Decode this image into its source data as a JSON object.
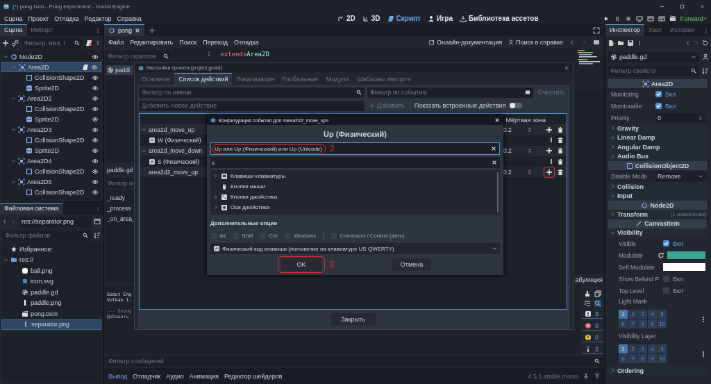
{
  "window": {
    "title": "(*) pong.tscn - Pong experiment - Godot Engine"
  },
  "menu": [
    "Сцена",
    "Проект",
    "Отладка",
    "Редактор",
    "Справка"
  ],
  "workspaces": [
    {
      "label": "2D",
      "kind": "plane",
      "selected": false
    },
    {
      "label": "3D",
      "kind": "space",
      "selected": false
    },
    {
      "label": "Скрипт",
      "kind": "script",
      "selected": true
    },
    {
      "label": "Игра",
      "kind": "game",
      "selected": false
    },
    {
      "label": "Библиотека ассетов",
      "kind": "assetlib",
      "selected": false
    }
  ],
  "renderer": "Forward+",
  "scene_dock": {
    "tabs": [
      {
        "label": "Сцена",
        "selected": true
      },
      {
        "label": "Импорт",
        "selected": false
      }
    ],
    "filter": {
      "placeholder": "Фильтр: имя, t"
    },
    "tree": [
      {
        "name": "Node2D",
        "kind": "node2d",
        "selected": false,
        "script": false,
        "expanded": true,
        "children": [
          {
            "name": "Area2D",
            "kind": "area",
            "selected": true,
            "script": true,
            "expanded": true,
            "children": [
              {
                "name": "CollisionShape2D",
                "kind": "shape",
                "selected": false,
                "script": false
              },
              {
                "name": "Sprite2D",
                "kind": "sprite",
                "selected": false,
                "script": false
              }
            ]
          },
          {
            "name": "Area2D2",
            "kind": "area",
            "selected": false,
            "script": false,
            "expanded": true,
            "children": [
              {
                "name": "CollisionShape2D",
                "kind": "shape",
                "selected": false,
                "script": false
              },
              {
                "name": "Sprite2D",
                "kind": "sprite",
                "selected": false,
                "script": false
              }
            ]
          },
          {
            "name": "Area2D3",
            "kind": "area",
            "selected": false,
            "script": false,
            "expanded": true,
            "children": [
              {
                "name": "CollisionShape2D",
                "kind": "shape",
                "selected": false,
                "script": false
              },
              {
                "name": "Sprite2D",
                "kind": "sprite",
                "selected": false,
                "script": false
              }
            ]
          },
          {
            "name": "Area2D4",
            "kind": "area",
            "selected": false,
            "script": false,
            "expanded": true,
            "children": [
              {
                "name": "CollisionShape2D",
                "kind": "shape",
                "selected": false,
                "script": false
              }
            ]
          },
          {
            "name": "Area2D5",
            "kind": "area",
            "selected": false,
            "script": false,
            "expanded": true,
            "children": [
              {
                "name": "CollisionShape2D",
                "kind": "shape",
                "selected": false,
                "script": false
              }
            ]
          }
        ]
      }
    ]
  },
  "filesystem": {
    "tab": "Файловая система",
    "path": "res://separator.png",
    "filter": {
      "placeholder": "Фильтр файлов"
    },
    "tree": [
      {
        "name": "Избранное:",
        "kind": "favorites",
        "selected": false
      },
      {
        "name": "res://",
        "kind": "folder",
        "selected": false,
        "expanded": true,
        "children": [
          {
            "name": "ball.png",
            "kind": "ball",
            "selected": false
          },
          {
            "name": "icon.svg",
            "kind": "svg",
            "selected": false
          },
          {
            "name": "paddle.gd",
            "kind": "script",
            "selected": false
          },
          {
            "name": "paddle.png",
            "kind": "paddle",
            "selected": false
          },
          {
            "name": "pong.tscn",
            "kind": "scene",
            "selected": false
          },
          {
            "name": "separator.png",
            "kind": "separator",
            "selected": true
          }
        ]
      }
    ]
  },
  "script_editor": {
    "tabs": [
      {
        "label": "pong",
        "selected": true
      }
    ],
    "menu": [
      "Файл",
      "Редактировать",
      "Поиск",
      "Переход",
      "Отладка"
    ],
    "links": [
      "Онлайн-документация",
      "Поиск в справке"
    ],
    "script_filter": {
      "placeholder": "Фильтр скриптов"
    },
    "scripts": [
      {
        "name": "paddl",
        "selected": true
      }
    ],
    "current_script": "paddle.gd",
    "method_filter": {
      "placeholder": "Фильтр м"
    },
    "methods": [
      "_ready",
      "_process",
      "_on_area_"
    ],
    "code": [
      {
        "line": "1",
        "tokens": [
          {
            "text": "extends",
            "kind": "keyword"
          },
          {
            "text": "Area2D",
            "kind": "type"
          }
        ]
      }
    ],
    "status_tab": "абуляция"
  },
  "output": {
    "lines": [
      {
        "text": "Godot Eng",
        "kind": "info"
      },
      {
        "text": "Vulkan 1.",
        "kind": "info"
      },
      {
        "text": "--- Debug",
        "kind": "debug"
      },
      {
        "text": "Добавить",
        "kind": "note"
      }
    ],
    "counts": [
      {
        "kind": "message",
        "count": "3"
      },
      {
        "kind": "error",
        "count": "0"
      },
      {
        "kind": "warning",
        "count": "0"
      },
      {
        "kind": "info",
        "count": "2"
      }
    ],
    "filter": {
      "placeholder": "Фильтр сообщений"
    }
  },
  "bottom_tabs": [
    {
      "label": "Вывод",
      "selected": true
    },
    {
      "label": "Отладчик",
      "selected": false
    },
    {
      "label": "Аудио",
      "selected": false
    },
    {
      "label": "Анимация",
      "selected": false
    },
    {
      "label": "Редактор шейдеров",
      "selected": false
    }
  ],
  "version": "4.5.1.stable.mono",
  "inspector": {
    "tabs": [
      {
        "label": "Инспектор",
        "selected": true
      },
      {
        "label": "Узел",
        "selected": false
      },
      {
        "label": "История",
        "selected": false
      }
    ],
    "resource": "paddle.gd",
    "filter": {
      "placeholder": "Фильтр свойств"
    },
    "items": [
      {
        "kind": "category",
        "label": "Area2D"
      },
      {
        "kind": "check",
        "label": "Monitoring",
        "checked": true,
        "value": "Вкл"
      },
      {
        "kind": "check",
        "label": "Monitorable",
        "checked": true,
        "value": "Вкл"
      },
      {
        "kind": "number",
        "label": "Priority",
        "value": "0"
      },
      {
        "kind": "group",
        "label": "Gravity",
        "expanded": false
      },
      {
        "kind": "group",
        "label": "Linear Damp",
        "expanded": false
      },
      {
        "kind": "group",
        "label": "Angular Damp",
        "expanded": false
      },
      {
        "kind": "group",
        "label": "Audio Bus",
        "expanded": false
      },
      {
        "kind": "category",
        "label": "CollisionObject2D"
      },
      {
        "kind": "select",
        "label": "Disable Mode",
        "value": "Remove"
      },
      {
        "kind": "group",
        "label": "Collision",
        "expanded": false
      },
      {
        "kind": "group",
        "label": "Input",
        "expanded": false
      },
      {
        "kind": "category",
        "label": "Node2D"
      },
      {
        "kind": "group",
        "label": "Transform",
        "expanded": false,
        "note": "(1 изменение)"
      },
      {
        "kind": "category",
        "label": "CanvasItem"
      },
      {
        "kind": "group",
        "label": "Visibility",
        "expanded": true,
        "children": [
          {
            "kind": "check",
            "label": "Visible",
            "checked": true,
            "value": "Вкл"
          },
          {
            "kind": "color",
            "label": "Modulate",
            "color": "#3aa58f",
            "revert": true
          },
          {
            "kind": "color",
            "label": "Self Modulate",
            "color": "#ffffff"
          },
          {
            "kind": "check",
            "label": "Show Behind P",
            "checked": false,
            "value": "Вкл"
          },
          {
            "kind": "check",
            "label": "Top Level",
            "checked": false,
            "value": "Вкл"
          },
          {
            "kind": "layers",
            "label": "Light Mask",
            "layers": [
              {
                "label": "1",
                "selected": true
              },
              {
                "label": "2",
                "selected": false
              },
              {
                "label": "3",
                "selected": false
              },
              {
                "label": "4",
                "selected": false
              },
              {
                "label": "5",
                "selected": false
              },
              {
                "label": "6",
                "selected": false
              },
              {
                "label": "7",
                "selected": false
              },
              {
                "label": "8",
                "selected": false
              },
              {
                "label": "9",
                "selected": false
              },
              {
                "label": "10",
                "selected": false
              }
            ]
          },
          {
            "kind": "layers",
            "label": "Visibility Layer",
            "layers": [
              {
                "label": "1",
                "selected": true
              },
              {
                "label": "2",
                "selected": false
              },
              {
                "label": "3",
                "selected": false
              },
              {
                "label": "4",
                "selected": false
              },
              {
                "label": "5",
                "selected": false
              },
              {
                "label": "6",
                "selected": false
              },
              {
                "label": "7",
                "selected": false
              },
              {
                "label": "8",
                "selected": false
              },
              {
                "label": "9",
                "selected": false
              },
              {
                "label": "10",
                "selected": false
              }
            ]
          }
        ]
      },
      {
        "kind": "group",
        "label": "Ordering",
        "expanded": false
      }
    ]
  },
  "project_settings": {
    "title": "Настройки проекта (project.godot)",
    "tabs": [
      {
        "label": "Основное",
        "selected": false
      },
      {
        "label": "Список действий",
        "selected": true
      },
      {
        "label": "Локализация",
        "selected": false
      },
      {
        "label": "Глобальные",
        "selected": false
      },
      {
        "label": "Модули",
        "selected": false
      },
      {
        "label": "Шаблоны импорта",
        "selected": false
      }
    ],
    "name_filter": {
      "placeholder": "Фильтр по имени"
    },
    "event_filter": {
      "placeholder": "Фильтр по событию"
    },
    "clear_button": "Очистить",
    "new_action": {
      "placeholder": "Добавить новое действие"
    },
    "add_button": "Добавить",
    "show_builtin": {
      "label": "Показать встроенные действия",
      "on": false
    },
    "deadzone_header": "Мёртвая зона",
    "actions": [
      {
        "name": "area2d_move_up",
        "deadzone": "0.2",
        "expanded": true,
        "add_highlighted": false,
        "events": [
          {
            "label": "W (Физический)"
          }
        ]
      },
      {
        "name": "area2d_move_down",
        "deadzone": "0.2",
        "expanded": true,
        "add_highlighted": false,
        "events": [
          {
            "label": "S (Физический)"
          }
        ]
      },
      {
        "name": "area2d2_move_up",
        "deadzone": "0.2",
        "add_highlighted": true
      }
    ],
    "close_button": "Закрыть"
  },
  "event_dialog": {
    "title": "Конфигурация события для «area2d2_move_up»",
    "heading": "Up (Физический)",
    "detected": {
      "value": "Up или Up (Физический) или Up (Unicode)",
      "highlighted": true,
      "step": "2"
    },
    "search": {
      "value": "s"
    },
    "categories": [
      {
        "label": "Клавиши клавиатуры",
        "kind": "keyboard"
      },
      {
        "label": "Кнопки мыши",
        "kind": "mouse"
      },
      {
        "label": "Кнопки джойстика",
        "kind": "joybutton"
      },
      {
        "label": "Оси джойстика",
        "kind": "joyaxis"
      }
    ],
    "options_title": "Дополнительные опции",
    "modifiers": [
      {
        "label": "Alt",
        "checked": false
      },
      {
        "label": "Shift",
        "checked": false
      },
      {
        "label": "Ctrl",
        "checked": false
      },
      {
        "label": "Windows",
        "checked": false
      },
      {
        "label": "Command / Control (авто)",
        "checked": false
      }
    ],
    "key_mode": "Физический код клавиши (положение на клавиатуре US QWERTY)",
    "ok_button": {
      "label": "OK",
      "highlighted": true,
      "step": "3"
    },
    "cancel_button": "Отмена"
  }
}
